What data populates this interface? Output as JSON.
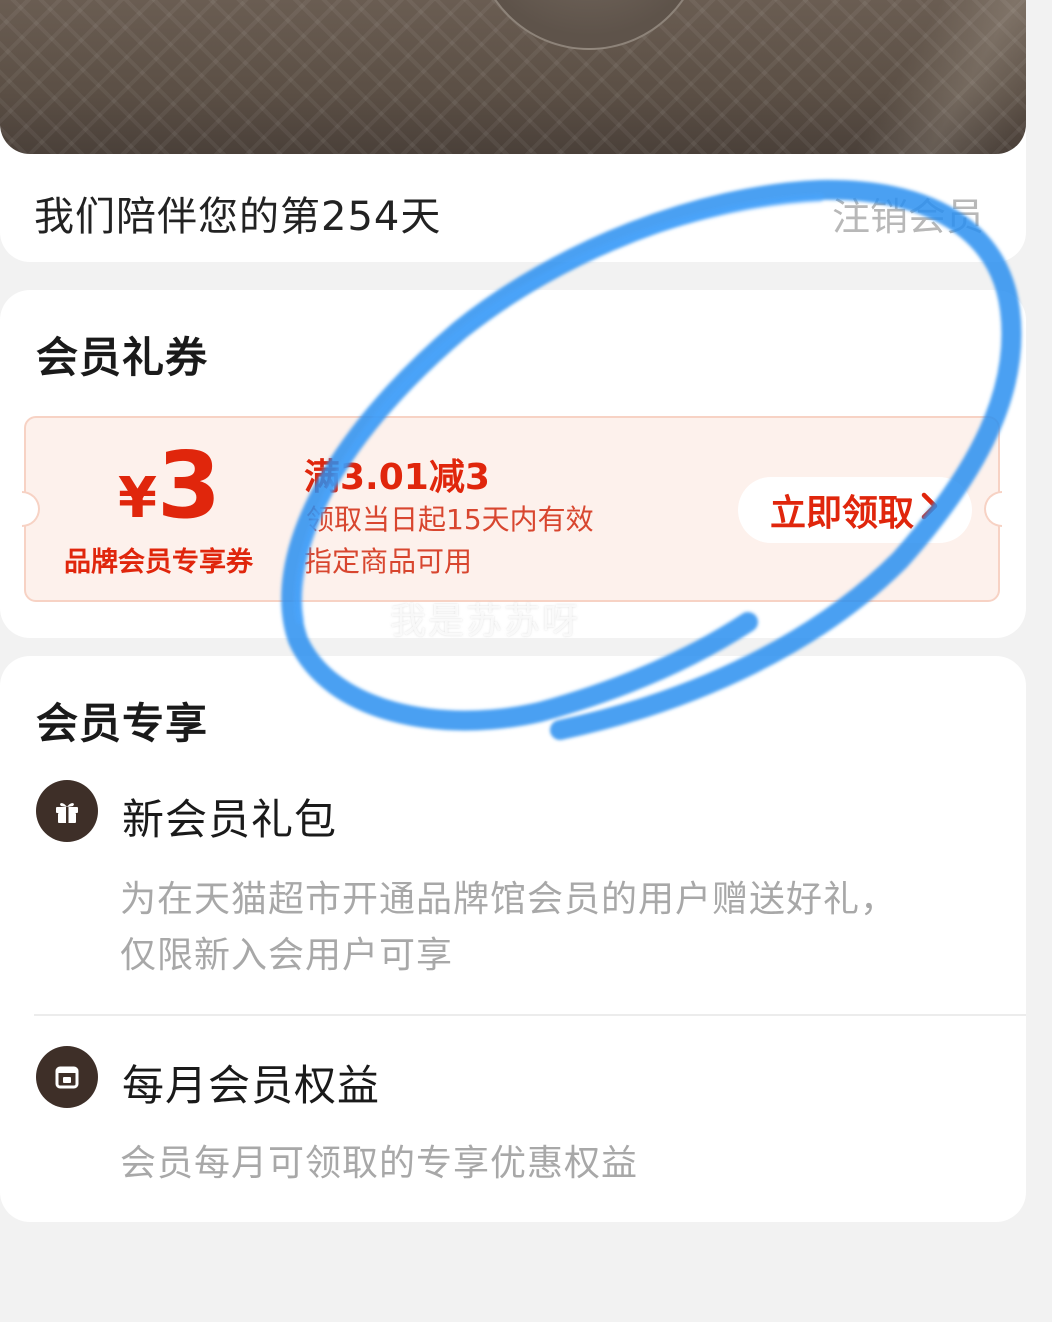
{
  "top_card": {
    "days_text": "我们陪伴您的第254天",
    "cancel_label": "注销会员"
  },
  "coupon_section": {
    "title": "会员礼券",
    "coupon": {
      "currency": "¥",
      "amount": "3",
      "type_label": "品牌会员专享券",
      "rule": "满3.01减3",
      "validity": "领取当日起15天内有效",
      "scope": "指定商品可用",
      "claim_label": "立即领取"
    },
    "watermark": "我是苏苏呀"
  },
  "benefits_section": {
    "title": "会员专享",
    "items": [
      {
        "icon": "gift-icon",
        "title": "新会员礼包",
        "desc_line1": "为在天猫超市开通品牌馆会员的用户赠送好礼，",
        "desc_line2": "仅限新入会用户可享"
      },
      {
        "icon": "calendar-icon",
        "title": "每月会员权益",
        "desc_line1": "会员每月可领取的专享优惠权益"
      }
    ]
  },
  "colors": {
    "accent_red": "#e0260c",
    "coupon_bg": "#fdf1ec",
    "icon_bg": "#3e2f28",
    "annotation_blue": "#2a8ff0"
  }
}
